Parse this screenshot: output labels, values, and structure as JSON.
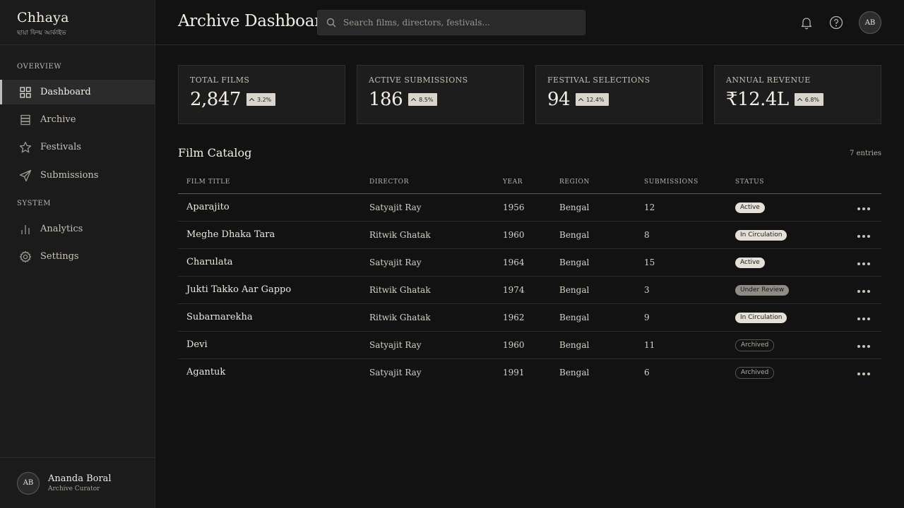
{
  "brand": {
    "name": "Chhaya",
    "subtitle": "ছায়া ফিল্ম আর্কাইভ"
  },
  "sidebar": {
    "sections": [
      "OVERVIEW",
      "SYSTEM"
    ],
    "items": [
      {
        "label": "Dashboard",
        "icon": "grid-icon",
        "active": true
      },
      {
        "label": "Archive",
        "icon": "database-icon",
        "active": false
      },
      {
        "label": "Festivals",
        "icon": "star-icon",
        "active": false
      },
      {
        "label": "Submissions",
        "icon": "send-icon",
        "active": false
      },
      {
        "label": "Analytics",
        "icon": "bar-chart-icon",
        "active": false
      },
      {
        "label": "Settings",
        "icon": "gear-icon",
        "active": false
      }
    ]
  },
  "user": {
    "initials": "AB",
    "name": "Ananda Boral",
    "role": "Archive Curator"
  },
  "header": {
    "title": "Archive Dashboard",
    "search_placeholder": "Search films, directors, festivals...",
    "avatar_initials": "AB",
    "icons": [
      "bell-icon",
      "help-icon"
    ]
  },
  "stats": [
    {
      "label": "TOTAL FILMS",
      "value": "2,847",
      "change": "3.2%"
    },
    {
      "label": "ACTIVE SUBMISSIONS",
      "value": "186",
      "change": "8.5%"
    },
    {
      "label": "FESTIVAL SELECTIONS",
      "value": "94",
      "change": "12.4%"
    },
    {
      "label": "ANNUAL REVENUE",
      "value": "₹12.4L",
      "change": "6.8%"
    }
  ],
  "catalog": {
    "title": "Film Catalog",
    "count": "7 entries",
    "columns": [
      "FILM TITLE",
      "DIRECTOR",
      "YEAR",
      "REGION",
      "SUBMISSIONS",
      "STATUS"
    ],
    "rows": [
      {
        "title": "Aparajito",
        "director": "Satyajit Ray",
        "year": "1956",
        "region": "Bengal",
        "submissions": "12",
        "status": "Active",
        "style": "light"
      },
      {
        "title": "Meghe Dhaka Tara",
        "director": "Ritwik Ghatak",
        "year": "1960",
        "region": "Bengal",
        "submissions": "8",
        "status": "In Circulation",
        "style": "light"
      },
      {
        "title": "Charulata",
        "director": "Satyajit Ray",
        "year": "1964",
        "region": "Bengal",
        "submissions": "15",
        "status": "Active",
        "style": "light"
      },
      {
        "title": "Jukti Takko Aar Gappo",
        "director": "Ritwik Ghatak",
        "year": "1974",
        "region": "Bengal",
        "submissions": "3",
        "status": "Under Review",
        "style": "mid"
      },
      {
        "title": "Subarnarekha",
        "director": "Ritwik Ghatak",
        "year": "1962",
        "region": "Bengal",
        "submissions": "9",
        "status": "In Circulation",
        "style": "light"
      },
      {
        "title": "Devi",
        "director": "Satyajit Ray",
        "year": "1960",
        "region": "Bengal",
        "submissions": "11",
        "status": "Archived",
        "style": "outline"
      },
      {
        "title": "Agantuk",
        "director": "Satyajit Ray",
        "year": "1991",
        "region": "Bengal",
        "submissions": "6",
        "status": "Archived",
        "style": "outline"
      }
    ]
  }
}
